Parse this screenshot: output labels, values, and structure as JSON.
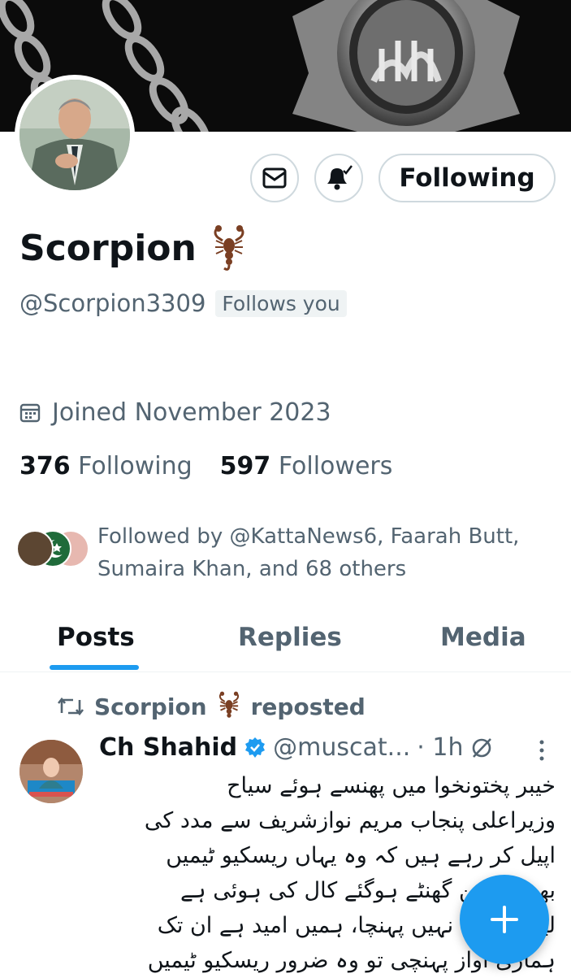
{
  "profile": {
    "name": "Scorpion",
    "handle": "@Scorpion3309",
    "follows_you": "Follows you",
    "joined": "Joined November 2023",
    "following_count": "376",
    "following_label": "Following",
    "followers_count": "597",
    "followers_label": "Followers",
    "followed_by_line1": "Followed by @KattaNews6, Faarah Butt,",
    "followed_by_line2": "Sumaira Khan, and 68 others"
  },
  "actions": {
    "following_button": "Following",
    "message_icon": "envelope-icon",
    "notification_icon": "bell-check-icon"
  },
  "tabs": [
    {
      "label": "Posts",
      "active": true
    },
    {
      "label": "Replies",
      "active": false
    },
    {
      "label": "Media",
      "active": false
    }
  ],
  "post": {
    "repost_name": "Scorpion",
    "repost_label": "reposted",
    "author_name": "Ch Shahid",
    "author_handle": "@muscat...",
    "time": "· 1h",
    "lines": [
      "خیبر پختونخوا میں پھنسے ہوئے سیاح",
      "وزیراعلی پنجاب مریم نوازشریف سے مدد کی",
      "اپیل کر رہے ہیں کہ وہ یہاں ریسکیو ٹیمیں",
      "بھیجیں تین گھنٹے ہوگئے کال کی ہوئی ہے",
      "لیکن کوئی نہیں پہنچا، ہمیں امید ہے ان تک",
      "ہماری آواز پہنچی تو وہ ضرور ریسکیو ٹیمیں"
    ]
  },
  "colors": {
    "accent": "#1d9bf0",
    "text_primary": "#0f1419",
    "text_secondary": "#536471",
    "border": "#cfd9de"
  },
  "fab_icon": "plus-icon"
}
